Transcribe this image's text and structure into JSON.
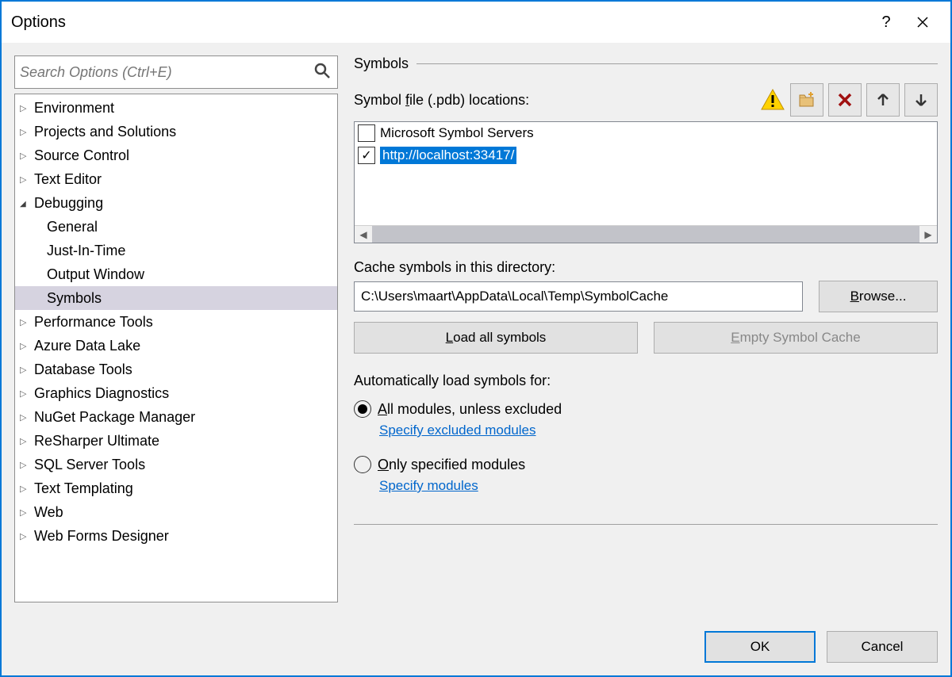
{
  "title": "Options",
  "search_placeholder": "Search Options (Ctrl+E)",
  "tree": [
    {
      "label": "Environment",
      "type": "collapsed"
    },
    {
      "label": "Projects and Solutions",
      "type": "collapsed"
    },
    {
      "label": "Source Control",
      "type": "collapsed"
    },
    {
      "label": "Text Editor",
      "type": "collapsed"
    },
    {
      "label": "Debugging",
      "type": "expanded"
    },
    {
      "label": "General",
      "type": "child"
    },
    {
      "label": "Just-In-Time",
      "type": "child"
    },
    {
      "label": "Output Window",
      "type": "child"
    },
    {
      "label": "Symbols",
      "type": "child",
      "selected": true
    },
    {
      "label": "Performance Tools",
      "type": "collapsed"
    },
    {
      "label": "Azure Data Lake",
      "type": "collapsed"
    },
    {
      "label": "Database Tools",
      "type": "collapsed"
    },
    {
      "label": "Graphics Diagnostics",
      "type": "collapsed"
    },
    {
      "label": "NuGet Package Manager",
      "type": "collapsed"
    },
    {
      "label": "ReSharper Ultimate",
      "type": "collapsed"
    },
    {
      "label": "SQL Server Tools",
      "type": "collapsed"
    },
    {
      "label": "Text Templating",
      "type": "collapsed"
    },
    {
      "label": "Web",
      "type": "collapsed"
    },
    {
      "label": "Web Forms Designer",
      "type": "collapsed"
    }
  ],
  "section": {
    "title": "Symbols",
    "locations_label": "Symbol file (.pdb) locations:",
    "locations": [
      {
        "label": "Microsoft Symbol Servers",
        "checked": false,
        "selected": false
      },
      {
        "label": "http://localhost:33417/",
        "checked": true,
        "selected": true
      }
    ],
    "cache_label": "Cache symbols in this directory:",
    "cache_path": "C:\\Users\\maart\\AppData\\Local\\Temp\\SymbolCache",
    "browse_label": "Browse...",
    "load_all_label": "Load all symbols",
    "empty_cache_label": "Empty Symbol Cache",
    "auto_label": "Automatically load symbols for:",
    "radio_all": "All modules, unless excluded",
    "link_excluded": "Specify excluded modules",
    "radio_only": "Only specified modules",
    "link_specify": "Specify modules"
  },
  "buttons": {
    "ok": "OK",
    "cancel": "Cancel"
  }
}
